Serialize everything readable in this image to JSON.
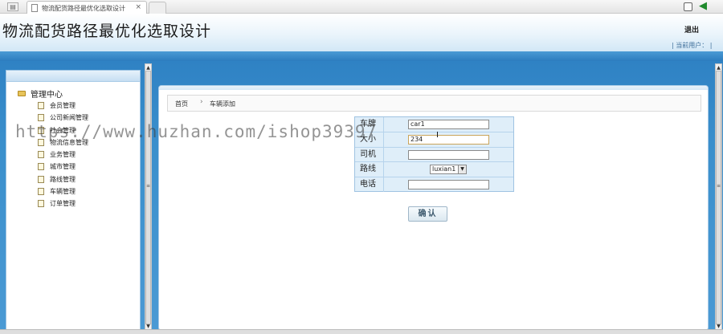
{
  "browser": {
    "tab_title": "物流配货路径最优化选取设计",
    "tab_close": "×"
  },
  "header": {
    "site_title": "物流配货路径最优化选取设计",
    "logout_label": "退出",
    "user_info": "| 当前用户： |"
  },
  "sidebar": {
    "root_label": "管理中心",
    "items": [
      {
        "label": "会员管理"
      },
      {
        "label": "公司新闻管理"
      },
      {
        "label": "社会管理"
      },
      {
        "label": "物流信息管理"
      },
      {
        "label": "业务管理"
      },
      {
        "label": "城市管理"
      },
      {
        "label": "路线管理"
      },
      {
        "label": "车辆管理"
      },
      {
        "label": "订单管理"
      }
    ]
  },
  "breadcrumb": {
    "home": "首页",
    "separator": "›",
    "current": "车辆添加"
  },
  "form": {
    "rows": [
      {
        "label": "车牌",
        "value": "car1"
      },
      {
        "label": "大小",
        "value": "234"
      },
      {
        "label": "司机",
        "value": ""
      },
      {
        "label": "路线",
        "value": "luxian1"
      },
      {
        "label": "电话",
        "value": ""
      }
    ],
    "submit_label": "确认"
  },
  "watermark": "https://www.huzhan.com/ishop39397"
}
